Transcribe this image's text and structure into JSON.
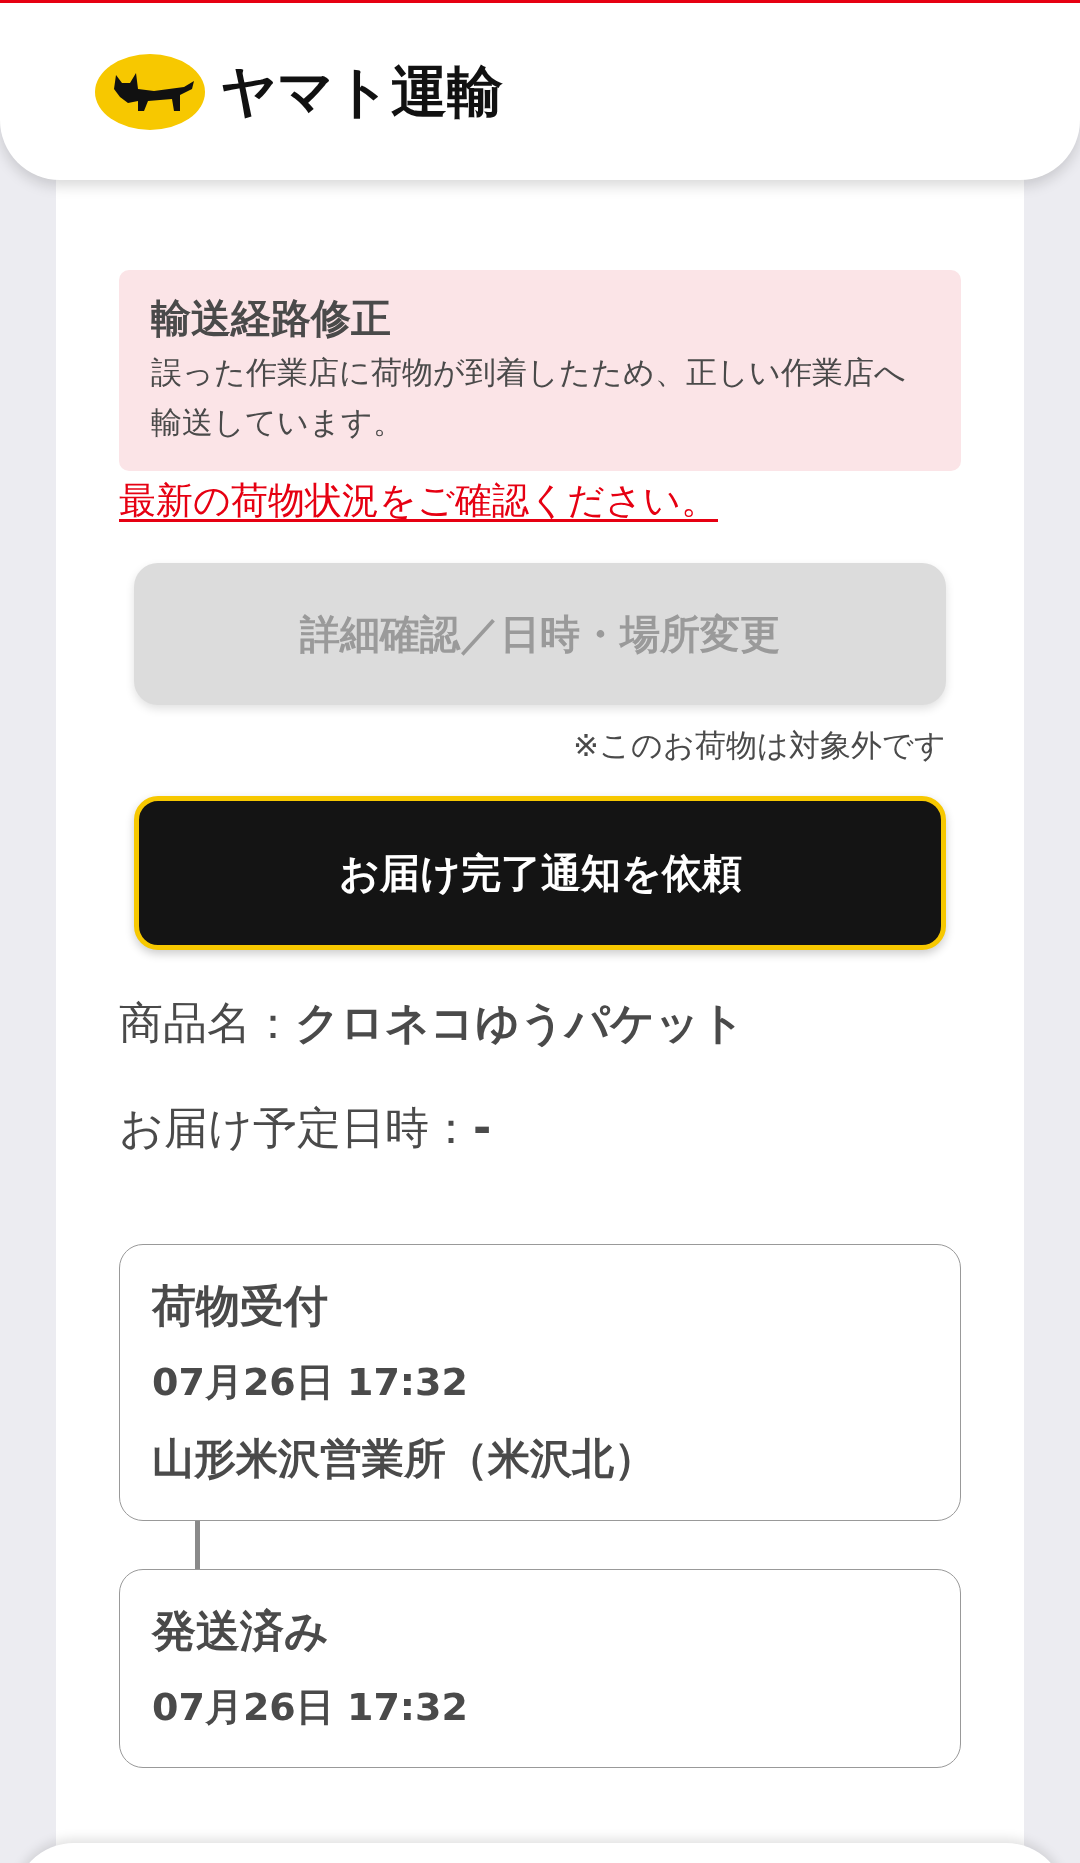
{
  "header": {
    "logo_text": "ヤマト運輸"
  },
  "notice": {
    "title": "輸送経路修正",
    "body": "誤った作業店に荷物が到着したため、正しい作業店へ輸送しています。"
  },
  "status_link": "最新の荷物状況をご確認ください。",
  "buttons": [
    {
      "kind": "disabled",
      "label": "詳細確認／日時・場所変更",
      "note": "※このお荷物は対象外です"
    },
    {
      "kind": "primary",
      "label": "お届け完了通知を依頼"
    }
  ],
  "details": [
    {
      "label": "商品名：",
      "value": "クロネコゆうパケット"
    },
    {
      "label": "お届け予定日時：",
      "value": "-"
    }
  ],
  "timeline": [
    {
      "status": "荷物受付",
      "datetime": "07月26日 17:32",
      "place": "山形米沢営業所（米沢北）"
    },
    {
      "status": "発送済み",
      "datetime": "07月26日 17:32"
    }
  ]
}
